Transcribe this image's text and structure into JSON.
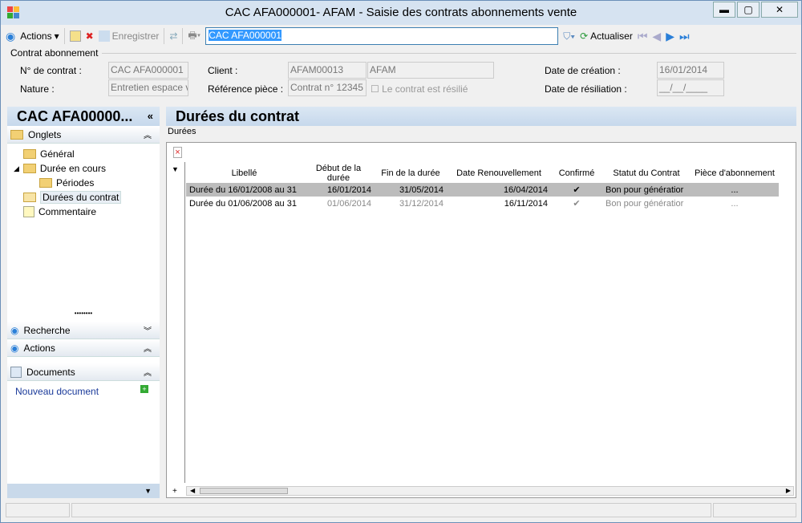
{
  "window": {
    "title": "CAC AFA000001- AFAM -  Saisie des contrats abonnements vente",
    "minimize": "▬",
    "maximize": "▢",
    "close": "✕"
  },
  "toolbar": {
    "actions": "Actions",
    "save": "Enregistrer",
    "search_value": "CAC AFA000001",
    "refresh": "Actualiser"
  },
  "form": {
    "group": "Contrat abonnement",
    "contract_no_label": "N° de contrat :",
    "contract_no": "CAC AFA000001",
    "nature_label": "Nature :",
    "nature": "Entretien espace ve",
    "client_label": "Client :",
    "client_code": "AFAM00013",
    "client_name": "AFAM",
    "ref_label": "Référence pièce :",
    "ref": "Contrat n° 12345",
    "resilie_label": "Le contrat  est résilié",
    "created_label": "Date de création :",
    "created": "16/01/2014",
    "resil_label": "Date de résiliation :",
    "resil": "__/__/____"
  },
  "left": {
    "title": "CAC AFA00000...",
    "collapse": "«",
    "onglets": "Onglets",
    "tree": [
      "Général",
      "Durée en cours",
      "Périodes",
      "Durées du contrat",
      "Commentaire"
    ],
    "recherche": "Recherche",
    "actions": "Actions",
    "documents": "Documents",
    "new_doc": "Nouveau document"
  },
  "main": {
    "title": "Durées du contrat",
    "group": "Durées",
    "columns": [
      "Libellé",
      "Début de la durée",
      "Fin de la durée",
      "Date Renouvellement",
      "Confirmé",
      "Statut du Contrat",
      "Pièce d'abonnement"
    ],
    "rows": [
      [
        "Durée du 16/01/2008 au 31",
        "16/01/2014",
        "31/05/2014",
        "16/04/2014",
        "✔",
        "Bon pour génératior",
        "..."
      ],
      [
        "Durée du 01/06/2008 au 31",
        "01/06/2014",
        "31/12/2014",
        "16/11/2014",
        "✔",
        "Bon pour génératior",
        "..."
      ]
    ]
  }
}
